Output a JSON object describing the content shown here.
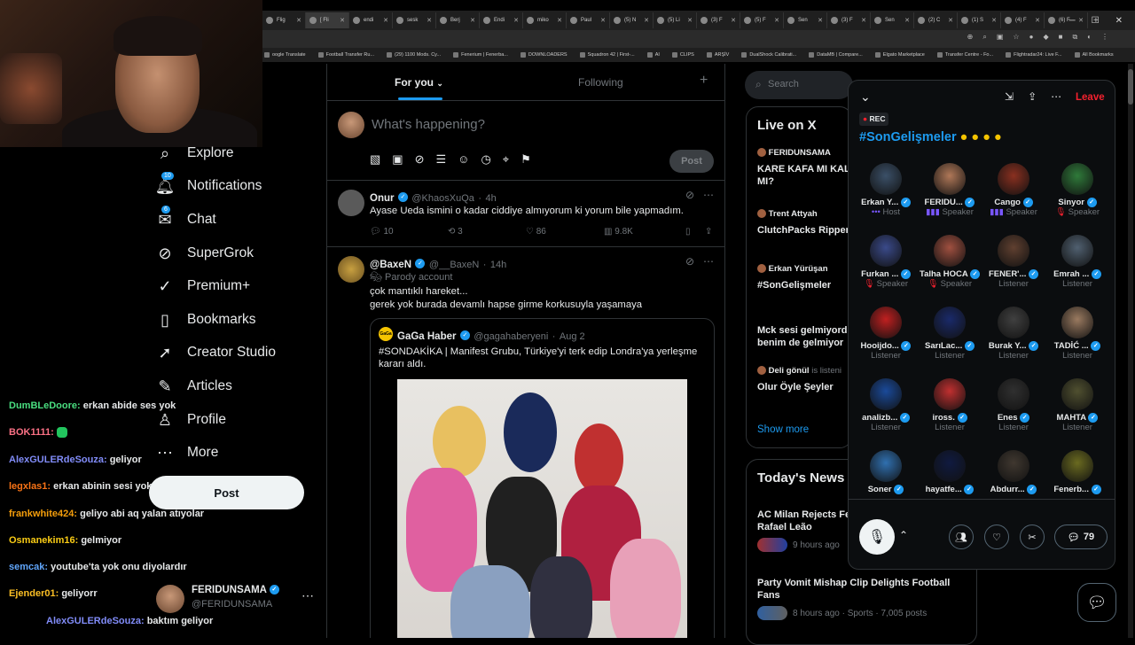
{
  "browser": {
    "tabs": [
      {
        "label": "Flig"
      },
      {
        "label": "[ Fli"
      },
      {
        "label": "endi"
      },
      {
        "label": "sesk"
      },
      {
        "label": "Berj"
      },
      {
        "label": "Endi"
      },
      {
        "label": "miko"
      },
      {
        "label": "Paul"
      },
      {
        "label": "(5) N"
      },
      {
        "label": "(5) Li"
      },
      {
        "label": "(3) F"
      },
      {
        "label": "(5) F"
      },
      {
        "label": "Sen"
      },
      {
        "label": "(3) F"
      },
      {
        "label": "Sen"
      },
      {
        "label": "(2) C"
      },
      {
        "label": "(1) S"
      },
      {
        "label": "(4) F"
      },
      {
        "label": "(6) F"
      }
    ],
    "bookmarks": [
      "oogle Translate",
      "Football Transfer Ru...",
      "(29) 1100 Mods. Cy...",
      "Fenerium | Fenerba...",
      "DOWNLOADERS",
      "Squadron 42 | First-...",
      "AI",
      "CLIPS",
      "ARŞİV",
      "DualShock Calibrati...",
      "DataMB | Compare...",
      "Elgato Marketplace",
      "Transfer Centre - Fo...",
      "Flightradar24: Live F...",
      "All Bookmarks"
    ]
  },
  "nav": {
    "explore": "Explore",
    "notifications": "Notifications",
    "notifications_badge": "10",
    "chat": "Chat",
    "chat_badge": "6",
    "supergrok": "SuperGrok",
    "premium": "Premium+",
    "bookmarks": "Bookmarks",
    "creator_studio": "Creator Studio",
    "articles": "Articles",
    "profile": "Profile",
    "more": "More",
    "post_button": "Post"
  },
  "account": {
    "name": "FERIDUNSAMA",
    "handle": "@FERIDUNSAMA"
  },
  "chat_messages": [
    {
      "user": "DumBLeDoore:",
      "msg": "erkan abide ses yok",
      "color": "#4ade80"
    },
    {
      "user": "BOK1111:",
      "msg": "",
      "color": "#fb7185"
    },
    {
      "user": "AlexGULERdeSouza:",
      "msg": "geliyor",
      "color": "#818cf8"
    },
    {
      "user": "legxlas1:",
      "msg": "erkan abinin sesi yok",
      "color": "#f97316"
    },
    {
      "user": "frankwhite424:",
      "msg": "geliyo abi aq yalan atıyolar",
      "color": "#f59e0b"
    },
    {
      "user": "Osmanekim16:",
      "msg": "gelmiyor",
      "color": "#facc15"
    },
    {
      "user": "semcak:",
      "msg": "youtube'ta yok onu diyolardır",
      "color": "#60a5fa"
    },
    {
      "user": "Ejender01:",
      "msg": "geliyorr",
      "color": "#fbbf24"
    },
    {
      "user": "AlexGULERdeSouza:",
      "msg": "baktım geliyor",
      "color": "#818cf8"
    }
  ],
  "timeline": {
    "tab_for_you": "For you",
    "tab_following": "Following",
    "compose_placeholder": "What's happening?",
    "compose_post": "Post",
    "tweets": [
      {
        "name": "Onur",
        "handle": "@KhaosXuQa",
        "time": "4h",
        "text": "Ayase Ueda ismini o kadar ciddiye almıyorum ki yorum bile yapmadım.",
        "replies": "10",
        "reposts": "3",
        "likes": "86",
        "views": "9.8K"
      },
      {
        "name": "@BaxeN",
        "handle": "@__BaxeN",
        "time": "14h",
        "label": "Parody account",
        "text1": "çok mantıklı hareket...",
        "text2": "gerek yok burada devamlı hapse girme korkusuyla yaşamaya",
        "quote": {
          "name": "GaGa Haber",
          "handle": "@gagahaberyeni",
          "time": "Aug 2",
          "text": "#SONDAKİKA | Manifest Grubu, Türkiye'yi terk edip Londra'ya yerleşme kararı aldı."
        }
      }
    ]
  },
  "right": {
    "search_placeholder": "Search",
    "live_title": "Live on X",
    "live_items": [
      {
        "user": "FERIDUNSAMA",
        "title": "KARE KAFA MI KAL",
        "title2": "MI?"
      },
      {
        "user": "Trent Attyah",
        "title": "ClutchPacks Ripper"
      },
      {
        "user": "Erkan Yürüşan",
        "title": "#SonGelişmeler"
      },
      {
        "user": "",
        "title": "Mck sesi gelmiyord",
        "title2": "benim de gelmiyor"
      },
      {
        "user": "Deli gönül",
        "suffix": "is listeni",
        "title": "Olur Öyle Şeyler"
      }
    ],
    "show_more": "Show more",
    "news_title": "Today's News",
    "news": [
      {
        "title": "AC Milan Rejects Fe",
        "title2": "Rafael Leão",
        "meta": "9 hours ago"
      },
      {
        "title": "Party Vomit Mishap Clip Delights Football",
        "title2": "Fans",
        "meta": "8 hours ago · Sports · 7,005 posts"
      }
    ]
  },
  "space": {
    "leave": "Leave",
    "rec": "REC",
    "title": "#SonGelişmeler",
    "comments": "79",
    "participants": [
      {
        "name": "Erkan Y...",
        "role": "Host",
        "color": "#3b5068"
      },
      {
        "name": "FERIDU...",
        "role": "Speaker",
        "color": "#b07858"
      },
      {
        "name": "Cango",
        "role": "Speaker",
        "color": "#8a3020"
      },
      {
        "name": "Sinyor",
        "role": "Speaker",
        "color": "#2f7a3a"
      },
      {
        "name": "Furkan ...",
        "role": "Speaker",
        "color": "#3a4a8a"
      },
      {
        "name": "Talha HOCA",
        "role": "Speaker",
        "color": "#a05040"
      },
      {
        "name": "FENER'...",
        "role": "Listener",
        "color": "#604030"
      },
      {
        "name": "Emrah ...",
        "role": "Listener",
        "color": "#506070"
      },
      {
        "name": "Hooijdo...",
        "role": "Listener",
        "color": "#c02020"
      },
      {
        "name": "SarıLac...",
        "role": "Listener",
        "color": "#1a2a6a"
      },
      {
        "name": "Burak Y...",
        "role": "Listener",
        "color": "#404040"
      },
      {
        "name": "TADİĆ ...",
        "role": "Listener",
        "color": "#9a7a60"
      },
      {
        "name": "analizb...",
        "role": "Listener",
        "color": "#1a4a9a"
      },
      {
        "name": "iross.",
        "role": "Listener",
        "color": "#c03030"
      },
      {
        "name": "Enes",
        "role": "Listener",
        "color": "#303030"
      },
      {
        "name": "MAHTA",
        "role": "Listener",
        "color": "#505030"
      },
      {
        "name": "Soner",
        "role": "",
        "color": "#3070b0"
      },
      {
        "name": "hayatfe...",
        "role": "",
        "color": "#101a40"
      },
      {
        "name": "Abdurr...",
        "role": "",
        "color": "#403830"
      },
      {
        "name": "Fenerb...",
        "role": "",
        "color": "#6a6a20"
      }
    ]
  },
  "colors": {
    "accent": "#1d9bf0",
    "leave": "#f4212e",
    "speaker_purple": "#7856ff"
  }
}
